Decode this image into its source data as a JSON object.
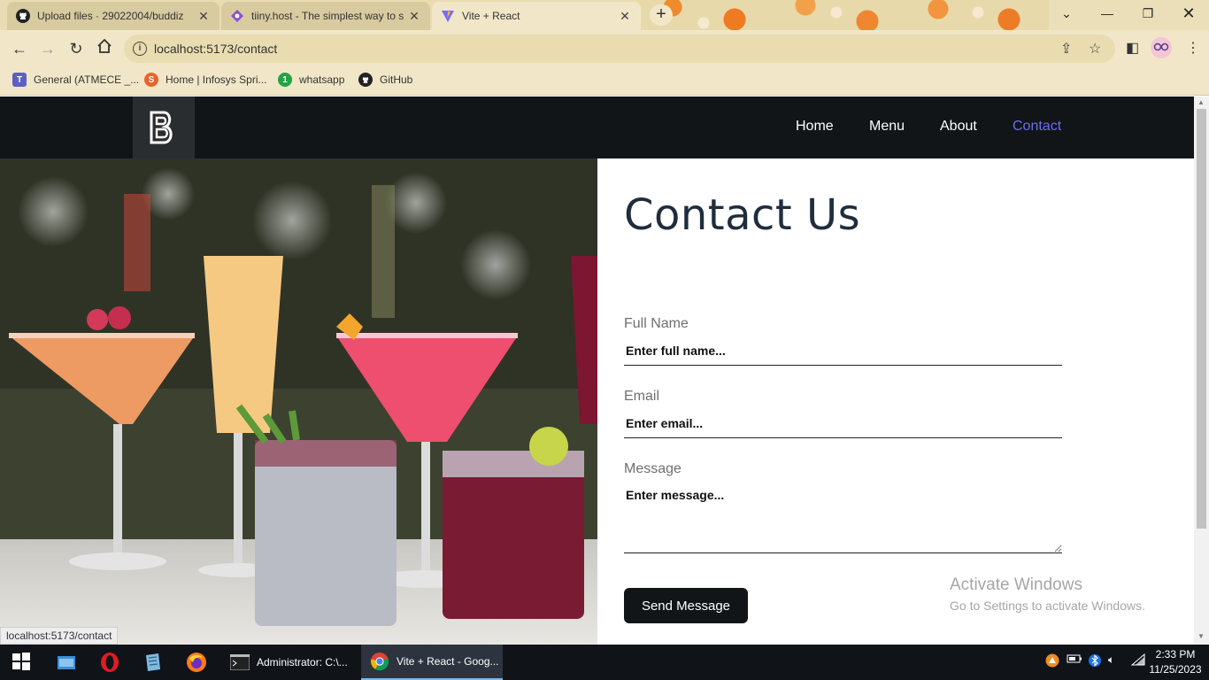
{
  "browser": {
    "tabs": [
      {
        "title": "Upload files · 29022004/buddiz",
        "active": false
      },
      {
        "title": "tiiny.host - The simplest way to s",
        "active": false
      },
      {
        "title": "Vite + React",
        "active": true
      }
    ],
    "url": "localhost:5173/contact",
    "bookmarks": [
      {
        "label": "General (ATMECE _...",
        "icon": "teams-icon"
      },
      {
        "label": "Home | Infosys Spri...",
        "icon": "infosys-icon"
      },
      {
        "label": "whatsapp",
        "icon": "whatsapp-icon",
        "badge": "1"
      },
      {
        "label": "GitHub",
        "icon": "github-icon"
      }
    ],
    "status_url": "localhost:5173/contact"
  },
  "site": {
    "nav": [
      {
        "label": "Home",
        "active": false
      },
      {
        "label": "Menu",
        "active": false
      },
      {
        "label": "About",
        "active": false
      },
      {
        "label": "Contact",
        "active": true
      }
    ],
    "accent_color": "#6a6cf6",
    "navbar_color": "#111518"
  },
  "contact": {
    "heading": "Contact Us",
    "fields": {
      "name": {
        "label": "Full Name",
        "placeholder": "Enter full name..."
      },
      "email": {
        "label": "Email",
        "placeholder": "Enter email..."
      },
      "message": {
        "label": "Message",
        "placeholder": "Enter message..."
      }
    },
    "submit_label": "Send Message"
  },
  "watermark": {
    "line1": "Activate Windows",
    "line2": "Go to Settings to activate Windows."
  },
  "taskbar": {
    "apps": [
      {
        "label": "Administrator:  C:\\...",
        "icon": "cmd-icon"
      },
      {
        "label": "Vite + React - Goog...",
        "icon": "chrome-icon",
        "active": true
      }
    ],
    "time": "2:33 PM",
    "date": "11/25/2023"
  }
}
